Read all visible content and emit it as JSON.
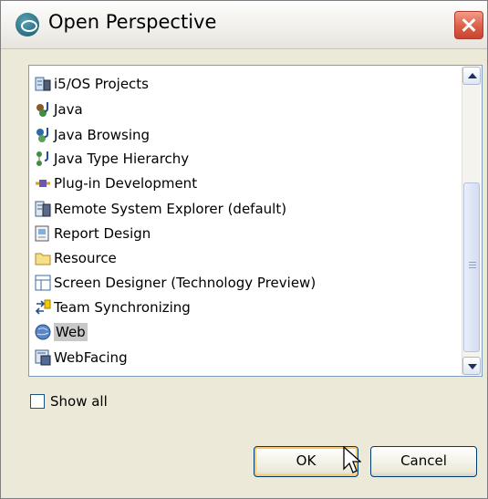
{
  "dialog": {
    "title": "Open Perspective",
    "app_icon": "eclipse-perspective-icon",
    "close_icon": "close-x-icon"
  },
  "perspectives": [
    {
      "label": "i5/OS Projects",
      "icon": "i5os-projects-icon"
    },
    {
      "label": "Java",
      "icon": "java-icon"
    },
    {
      "label": "Java Browsing",
      "icon": "java-browsing-icon"
    },
    {
      "label": "Java Type Hierarchy",
      "icon": "java-type-hierarchy-icon"
    },
    {
      "label": "Plug-in Development",
      "icon": "plugin-development-icon"
    },
    {
      "label": "Remote System Explorer (default)",
      "icon": "remote-system-explorer-icon"
    },
    {
      "label": "Report Design",
      "icon": "report-design-icon"
    },
    {
      "label": "Resource",
      "icon": "resource-folder-icon"
    },
    {
      "label": "Screen Designer (Technology Preview)",
      "icon": "screen-designer-icon"
    },
    {
      "label": "Team Synchronizing",
      "icon": "team-synchronizing-icon"
    },
    {
      "label": "Web",
      "icon": "web-globe-icon",
      "selected": true
    },
    {
      "label": "WebFacing",
      "icon": "webfacing-icon"
    }
  ],
  "show_all": {
    "label": "Show all",
    "checked": false
  },
  "buttons": {
    "ok": "OK",
    "cancel": "Cancel"
  },
  "colors": {
    "selection": "#c8c8c8",
    "list_border": "#7f9db9",
    "close_button": "#dc5f47",
    "default_button_glow": "#f8c870"
  }
}
